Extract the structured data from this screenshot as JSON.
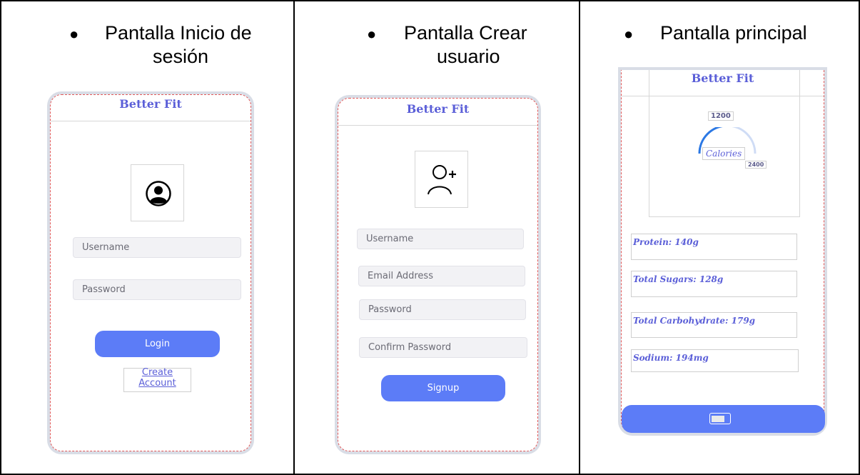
{
  "columns": [
    {
      "heading_line1": "Pantalla Inicio de",
      "heading_line2": "sesión"
    },
    {
      "heading_line1": "Pantalla Crear",
      "heading_line2": "usuario"
    },
    {
      "heading_line1": "Pantalla principal",
      "heading_line2": ""
    }
  ],
  "bullet": "●",
  "login": {
    "title": "Better Fit",
    "username_placeholder": "Username",
    "password_placeholder": "Password",
    "login_label": "Login",
    "create_account_label": "Create Account"
  },
  "signup": {
    "title": "Better Fit",
    "username_placeholder": "Username",
    "email_placeholder": "Email Address",
    "password_placeholder": "Password",
    "confirm_placeholder": "Confirm Password",
    "signup_label": "Signup"
  },
  "main": {
    "title": "Better Fit",
    "calories_value": "1200",
    "calories_label": "Calories",
    "calories_goal": "2400",
    "calories_fraction": 0.5,
    "stats": [
      {
        "label": "Protein: 140g"
      },
      {
        "label": "Total Sugars: 128g"
      },
      {
        "label": "Total Carbohydrate: 179g"
      },
      {
        "label": "Sodium: 194mg"
      }
    ]
  },
  "colors": {
    "accent": "#5c7cf7",
    "title": "#5b5fd8",
    "frame_dash": "#e35a5a"
  },
  "icons": [
    "user-circle-icon",
    "user-add-icon",
    "calories-gauge-icon",
    "toggle-icon"
  ]
}
